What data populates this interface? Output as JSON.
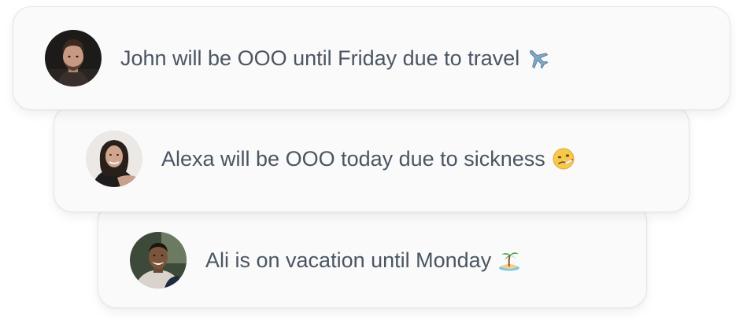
{
  "notifications": [
    {
      "person": "John",
      "text": "John will be OOO until Friday due to travel",
      "emoji": "airplane-icon"
    },
    {
      "person": "Alexa",
      "text": "Alexa will be OOO today due to sickness",
      "emoji": "sick-face-icon"
    },
    {
      "person": "Ali",
      "text": "Ali is on vacation until Monday",
      "emoji": "island-icon"
    }
  ],
  "colors": {
    "card_background": "#fafafa",
    "card_border": "#e6e6e6",
    "text": "#4b5563"
  }
}
